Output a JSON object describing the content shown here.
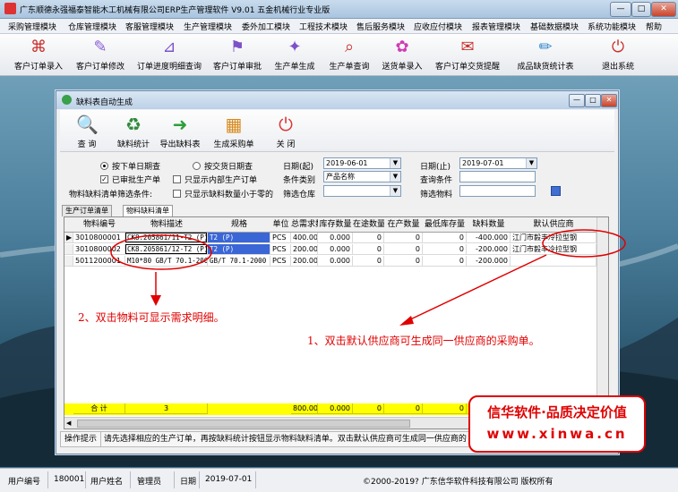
{
  "window": {
    "title": "广东顺德永强福泰智能木工机械有限公司ERP生产管理软件   V9.01 五金机械行业专业版",
    "min": "—",
    "max": "□",
    "close": "✕"
  },
  "menu": [
    "采购管理模块",
    "仓库管理模块",
    "客服管理模块",
    "生产管理模块",
    "委外加工模块",
    "工程技术模块",
    "售后服务模块",
    "应收应付模块",
    "报表管理模块",
    "基础数据模块",
    "系统功能模块",
    "帮助"
  ],
  "toolbar": [
    {
      "label": "客户订单录入",
      "icon": "pdf-icon",
      "glyph": "⌘",
      "color": "#c9302c"
    },
    {
      "label": "客户订单修改",
      "icon": "edit-icon",
      "glyph": "✎",
      "color": "#8b5cd6"
    },
    {
      "label": "订单进度明细查询",
      "icon": "progress-icon",
      "glyph": "⊿",
      "color": "#7c52c9"
    },
    {
      "label": "客户订单审批",
      "icon": "approve-icon",
      "glyph": "⚑",
      "color": "#7c52c9"
    },
    {
      "label": "生产单生成",
      "icon": "generate-icon",
      "glyph": "✦",
      "color": "#7c52c9"
    },
    {
      "label": "生产单查询",
      "icon": "query-icon",
      "glyph": "⌕",
      "color": "#c9302c"
    },
    {
      "label": "送货单录入",
      "icon": "delivery-icon",
      "glyph": "✿",
      "color": "#d13bb5"
    },
    {
      "label": "客户订单交货提醒",
      "icon": "remind-icon",
      "glyph": "✉",
      "color": "#c9302c"
    },
    {
      "label": "成品缺货统计表",
      "icon": "stats-icon",
      "glyph": "✏",
      "color": "#2f86c9"
    },
    {
      "label": "退出系统",
      "icon": "exit-icon",
      "glyph": "⏻",
      "color": "#c9302c"
    }
  ],
  "child": {
    "title": "缺料表自动生成",
    "tools": [
      {
        "label": "查  询",
        "icon": "magnifier-icon",
        "glyph": "🔍",
        "color": "#333"
      },
      {
        "label": "缺料统计",
        "icon": "recycle-icon",
        "glyph": "♻",
        "color": "#2e8b3c"
      },
      {
        "label": "导出缺料表",
        "icon": "arrow-right-icon",
        "glyph": "➜",
        "color": "#2e9e3a"
      },
      {
        "label": "生成采购单",
        "icon": "boxes-icon",
        "glyph": "▦",
        "color": "#d88a1c"
      },
      {
        "label": "关  闭",
        "icon": "power-icon",
        "glyph": "⏻",
        "color": "#d33"
      }
    ],
    "filters": {
      "radio1": "按下单日期查",
      "radio2": "按交货日期查",
      "chk1": "已审批生产单",
      "chk2": "只显示内部生产订单",
      "chk3": "只显示缺料数量小于零的",
      "screen_label": "物料缺料清单筛选条件:",
      "date_from_label": "日期(起)",
      "date_from": "2019-06-01",
      "date_to_label": "日期(止)",
      "date_to": "2019-07-01",
      "cond_type_label": "条件类别",
      "cond_type": "产品名称",
      "query_cond_label": "查询条件",
      "warehouse_label": "筛选仓库",
      "material_label": "筛选物料"
    },
    "tabs": [
      "生产订单清单",
      "物料缺料清单"
    ],
    "columns": [
      "物料编号",
      "物料描述",
      "规格",
      "单位",
      "总需求数量",
      "库存数量",
      "在途数量",
      "在产数量",
      "最低库存量",
      "缺料数量",
      "默认供应商"
    ],
    "rows": [
      [
        "3010800001",
        "CK8.205861/11-T2 (P)",
        "T2 (P)",
        "PCS",
        "400.000",
        "0.000",
        "0",
        "0",
        "0",
        "-400.000",
        "江门市毅丰冷拉型钢"
      ],
      [
        "3010800002",
        "CK8.205861/12-T2 (P)",
        "T2 (P)",
        "PCS",
        "200.000",
        "0.000",
        "0",
        "0",
        "0",
        "-200.000",
        "江门市毅丰冷拉型钢"
      ],
      [
        "5011200001",
        "M10*80 GB/T 70.1-2000",
        "GB/T 70.1-2000",
        "PCS",
        "200.000",
        "0.000",
        "0",
        "0",
        "0",
        "-200.000",
        ""
      ]
    ],
    "summary": {
      "label": "合  计",
      "count": "3",
      "total": "800.000",
      "stock": "0.000",
      "transit": "0",
      "producing": "0",
      "min": "0",
      "short": "-800"
    },
    "hint_label": "操作提示",
    "hint_text": "请先选择相应的生产订单，再按缺料统计按钮显示物料缺料清单。双击默认供应商可生成同一供应商的"
  },
  "annotations": {
    "note1": "1、双击默认供应商可生成同一供应商的采购单。",
    "note2": "2、双击物料可显示需求明细。",
    "watermark1": "信华软件·品质决定价值",
    "watermark2": "www.xinwa.cn"
  },
  "status": {
    "user_no_label": "用户编号",
    "user_no": "180001",
    "user_name_label": "用户姓名",
    "user_name": "管理员",
    "date_label": "日期",
    "date": "2019-07-01",
    "copyright": "©2000-2019?   广东信华软件科技有限公司   版权所有"
  }
}
